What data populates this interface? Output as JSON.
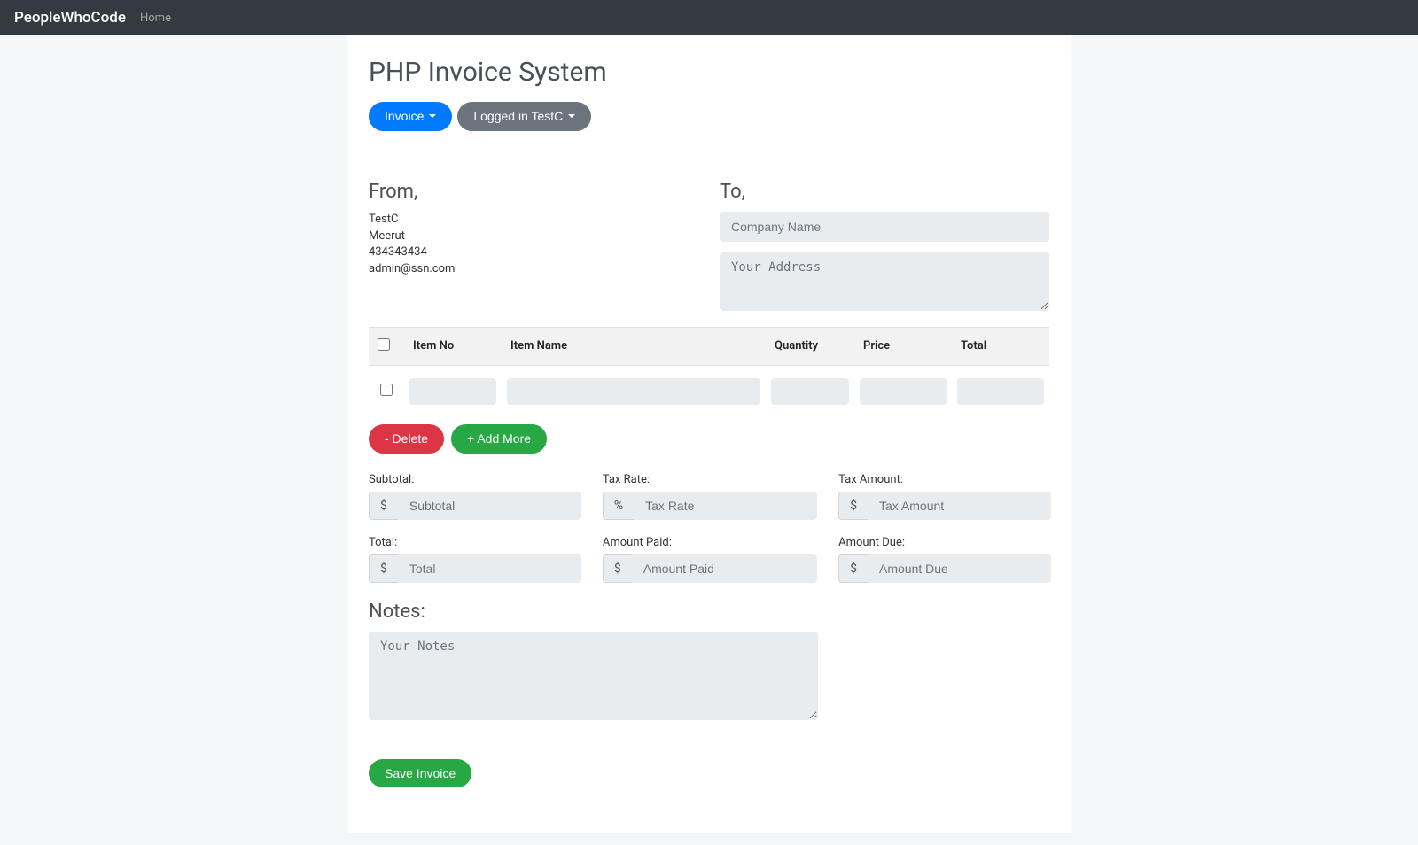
{
  "nav": {
    "brand": "PeopleWhoCode",
    "home": "Home"
  },
  "header": {
    "title": "PHP Invoice System",
    "invoice_btn": "Invoice",
    "user_btn": "Logged in TestC"
  },
  "from": {
    "label": "From,",
    "name": "TestC",
    "city": "Meerut",
    "phone": "434343434",
    "email": "admin@ssn.com"
  },
  "to": {
    "label": "To,",
    "company_placeholder": "Company Name",
    "address_placeholder": "Your Address"
  },
  "table": {
    "headers": {
      "item_no": "Item No",
      "item_name": "Item Name",
      "quantity": "Quantity",
      "price": "Price",
      "total": "Total"
    }
  },
  "actions": {
    "delete": "- Delete",
    "add": "+ Add More"
  },
  "totals": {
    "subtotal_label": "Subtotal:",
    "subtotal_placeholder": "Subtotal",
    "taxrate_label": "Tax Rate:",
    "taxrate_placeholder": "Tax Rate",
    "taxamount_label": "Tax Amount:",
    "taxamount_placeholder": "Tax Amount",
    "total_label": "Total:",
    "total_placeholder": "Total",
    "paid_label": "Amount Paid:",
    "paid_placeholder": "Amount Paid",
    "due_label": "Amount Due:",
    "due_placeholder": "Amount Due",
    "currency": "$",
    "percent": "%"
  },
  "notes": {
    "label": "Notes:",
    "placeholder": "Your Notes"
  },
  "save": {
    "label": "Save Invoice"
  }
}
